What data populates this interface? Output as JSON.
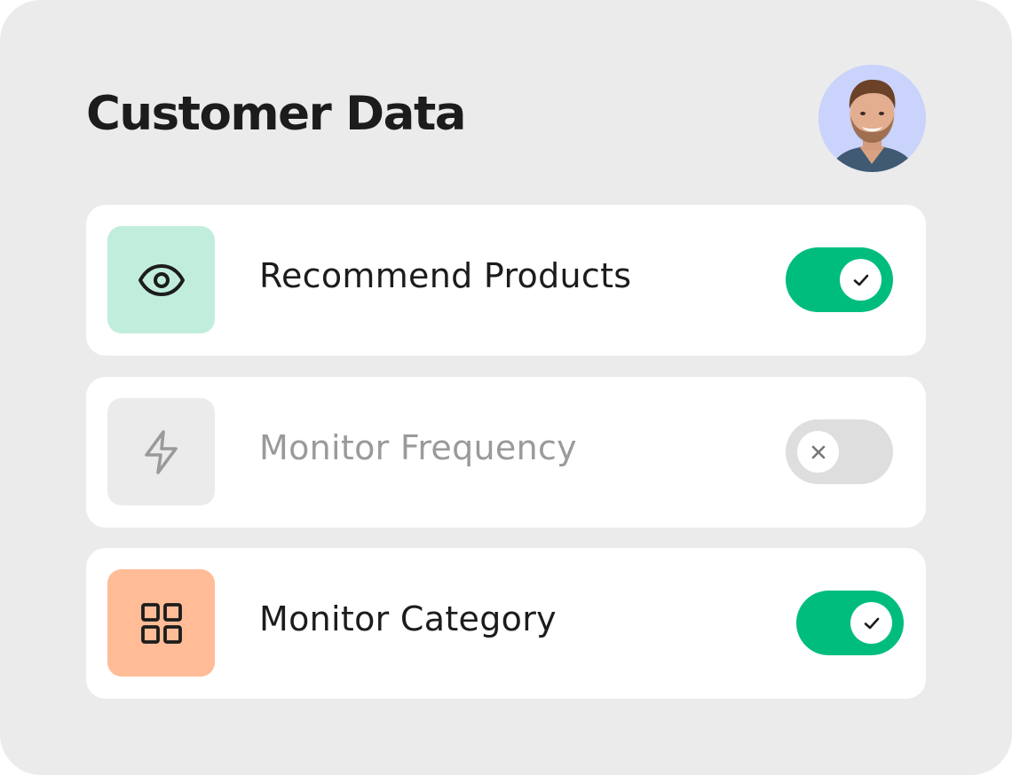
{
  "card": {
    "title": "Customer Data",
    "background_color": "#ebebeb"
  },
  "avatar": {
    "icon": "user-avatar-photo",
    "background_color": "#c9d3fb"
  },
  "settings": [
    {
      "label": "Recommend Products",
      "icon": "eye-icon",
      "icon_tile_color": "#c1eddc",
      "enabled": true,
      "toggle_icon": "check-icon",
      "toggle_color": "#00bd7e"
    },
    {
      "label": "Monitor Frequency",
      "icon": "lightning-icon",
      "icon_tile_color": "#ebebeb",
      "enabled": false,
      "toggle_icon": "close-icon",
      "toggle_color": "#dedede"
    },
    {
      "label": "Monitor Category",
      "icon": "grid-icon",
      "icon_tile_color": "#ffbc97",
      "enabled": true,
      "toggle_icon": "check-icon",
      "toggle_color": "#00bd7e"
    }
  ]
}
